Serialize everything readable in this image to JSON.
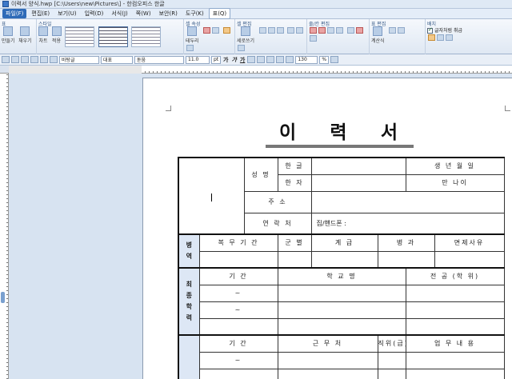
{
  "window": {
    "title": "이력서 양식.hwp [C:\\Users\\new\\Pictures\\] - 한컴오피스 한글"
  },
  "menubar": {
    "items": [
      {
        "label": "파일(F)"
      },
      {
        "label": "편집(E)"
      },
      {
        "label": "보기(U)"
      },
      {
        "label": "입력(D)"
      },
      {
        "label": "서식(J)"
      },
      {
        "label": "쪽(W)"
      },
      {
        "label": "보안(R)"
      },
      {
        "label": "도구(K)"
      },
      {
        "label": "표(Q)"
      }
    ]
  },
  "ribbon": {
    "groups": [
      {
        "label": "표",
        "buttons": [
          "만들기",
          "채우기"
        ]
      },
      {
        "label": "스타일",
        "buttons": [
          "차트",
          "적용",
          "옵션"
        ]
      },
      {
        "label": "셀 속성",
        "buttons": [
          "테두리",
          "셀 배경"
        ]
      },
      {
        "label": "셀 편집",
        "buttons": [
          "세로쓰기"
        ]
      },
      {
        "label": "줄/칸 편집",
        "buttons": []
      },
      {
        "label": "표 편집",
        "buttons": [
          "계산식"
        ]
      },
      {
        "label": "배치",
        "buttons": [
          "글자처럼 취급"
        ]
      }
    ]
  },
  "fmtbar": {
    "style": "바탕글",
    "font_lang": "대표",
    "font": "돋움",
    "size": "11.0",
    "size_unit": "pt",
    "zoom": "130",
    "zoom_unit": "%"
  },
  "document": {
    "title_chars": [
      "이",
      "력",
      "서"
    ],
    "table": {
      "name_label": "성 명",
      "hangul": "한 글",
      "hanja": "한 자",
      "birth": "생 년 월 일",
      "age": "만 나이",
      "address": "주 소",
      "contact": "연 락 처",
      "phone": "집/핸드폰 :",
      "military": {
        "section": "병 역",
        "headers": [
          "복 무 기 간",
          "군 별",
          "계 급",
          "병 과",
          "면제사유"
        ]
      },
      "education": {
        "section": "최 종 학 력",
        "headers": [
          "기 간",
          "학 교 명",
          "전 공 (학 위)"
        ],
        "tilde": "~"
      },
      "career": {
        "headers": [
          "기 간",
          "근 무 처",
          "직위(급)",
          "업 무 내 용"
        ],
        "tilde": "~"
      }
    }
  },
  "colors": {
    "menu_accent": "#2e6bb8",
    "section_bg": "#dde7f5",
    "workspace_bg": "#d7e3f1"
  }
}
